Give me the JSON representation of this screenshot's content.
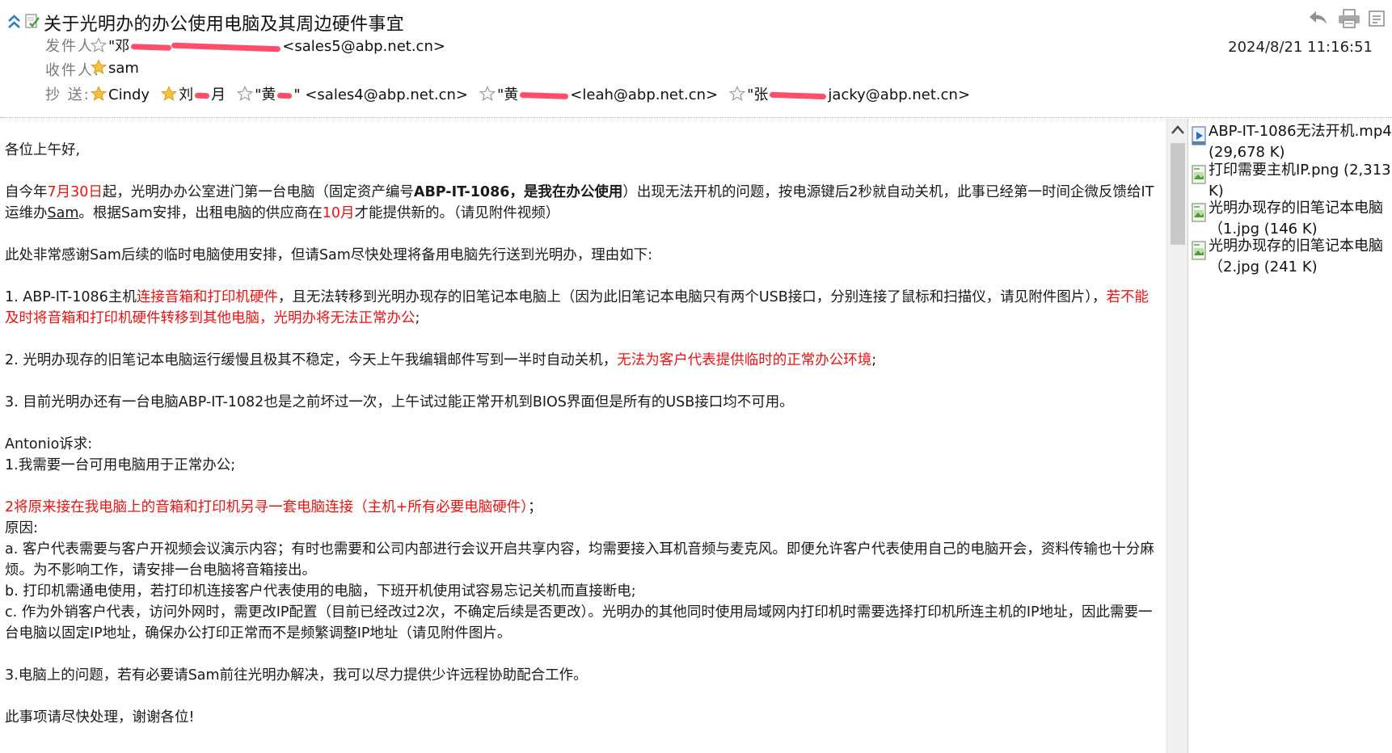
{
  "header": {
    "subject": "关于光明办的办公使用电脑及其周边硬件事宜",
    "from_label": "发件人:",
    "from_value_prefix": "\"邓",
    "from_value_suffix": "<sales5@abp.net.cn>",
    "to_label": "收件人:",
    "to_value": "sam",
    "cc_label": "抄  送:",
    "cc": [
      {
        "text": "Cindy"
      },
      {
        "text": "刘",
        "tail": "月"
      },
      {
        "text": "\"黄",
        "tail": "\" <sales4@abp.net.cn>"
      },
      {
        "text": "\"黄",
        "tail": "<leah@abp.net.cn>"
      },
      {
        "text": "\"张",
        "tail": "jacky@abp.net.cn>"
      }
    ],
    "datetime": "2024/8/21 11:16:51"
  },
  "body": {
    "greeting": "各位上午好,",
    "p1": {
      "a": "自今年",
      "b": "7月30日",
      "c": "起，光明办办公室进门第一台电脑（固定资产编号",
      "d": "ABP-IT-1086，是我在办公使用",
      "e": "）出现无法开机的问题，按电源键后2秒就自动关机，此事已经第一时间企微反馈给IT运维办",
      "f": "Sam",
      "g": "。根据Sam安排，出租电脑的供应商在",
      "h": "10月",
      "i": "才能提供新的。（请见附件视频）"
    },
    "p2": "此处非常感谢Sam后续的临时电脑使用安排，但请Sam尽快处理将备用电脑先行送到光明办，理由如下:",
    "p3": {
      "a": "1. ABP-IT-1086主机",
      "b": "连接音箱和打印机硬件",
      "c": "，且无法转移到光明办现存的旧笔记本电脑上（因为此旧笔记本电脑只有两个USB接口，分别连接了鼠标和扫描仪，请见附件图片），",
      "d": "若不能及时将音箱和打印机硬件转移到其他电脑，光明办将无法正常办公",
      "e": ";"
    },
    "p4": {
      "a": "2. 光明办现存的旧笔记本电脑运行缓慢且极其不稳定，今天上午我编辑邮件写到一半时自动关机，",
      "b": "无法为客户代表提供临时的正常办公环境",
      "c": ";"
    },
    "p5": "3. 目前光明办还有一台电脑ABP-IT-1082也是之前坏过一次，上午试过能正常开机到BIOS界面但是所有的USB接口均不可用。",
    "p6": "Antonio诉求:",
    "p7": "1.我需要一台可用电脑用于正常办公;",
    "p8": {
      "a": "2",
      "b": "将原来接在我电脑上的音箱和打印机另寻一套电脑连接（主机+所有必要电脑硬件）",
      "c": "；"
    },
    "p9": "原因:",
    "p10": "a. 客户代表需要与客户开视频会议演示内容；有时也需要和公司内部进行会议开启共享内容，均需要接入耳机音频与麦克风。即便允许客户代表使用自己的电脑开会，资料传输也十分麻烦。为不影响工作，请安排一台电脑将音箱接出。",
    "p11": "b. 打印机需通电使用，若打印机连接客户代表使用的电脑，下班开机使用试容易忘记关机而直接断电;",
    "p12": "c. 作为外销客户代表，访问外网时，需更改IP配置（目前已经改过2次，不确定后续是否更改）。光明办的其他同时使用局域网内打印机时需要选择打印机所连主机的IP地址，因此需要一台电脑以固定IP地址，确保办公打印正常而不是频繁调整IP地址（请见附件图片。",
    "p13": "3.电脑上的问题，若有必要请Sam前往光明办解决，我可以尽力提供少许远程协助配合工作。",
    "p14": "此事项请尽快处理，谢谢各位!"
  },
  "attachments": [
    {
      "name": "ABP-IT-1086无法开机.mp4 (29,678 K)",
      "icon": "video-file-icon"
    },
    {
      "name": "打印需要主机IP.png (2,313 K)",
      "icon": "image-file-icon"
    },
    {
      "name": "光明办现存的旧笔记本电脑（1.jpg (146 K)",
      "icon": "image-file-icon"
    },
    {
      "name": "光明办现存的旧笔记本电脑（2.jpg (241 K)",
      "icon": "image-file-icon"
    }
  ],
  "colors": {
    "accent_red": "#ee1111",
    "redaction": "#ff4d6a",
    "label_gray": "#7a7a7a"
  }
}
